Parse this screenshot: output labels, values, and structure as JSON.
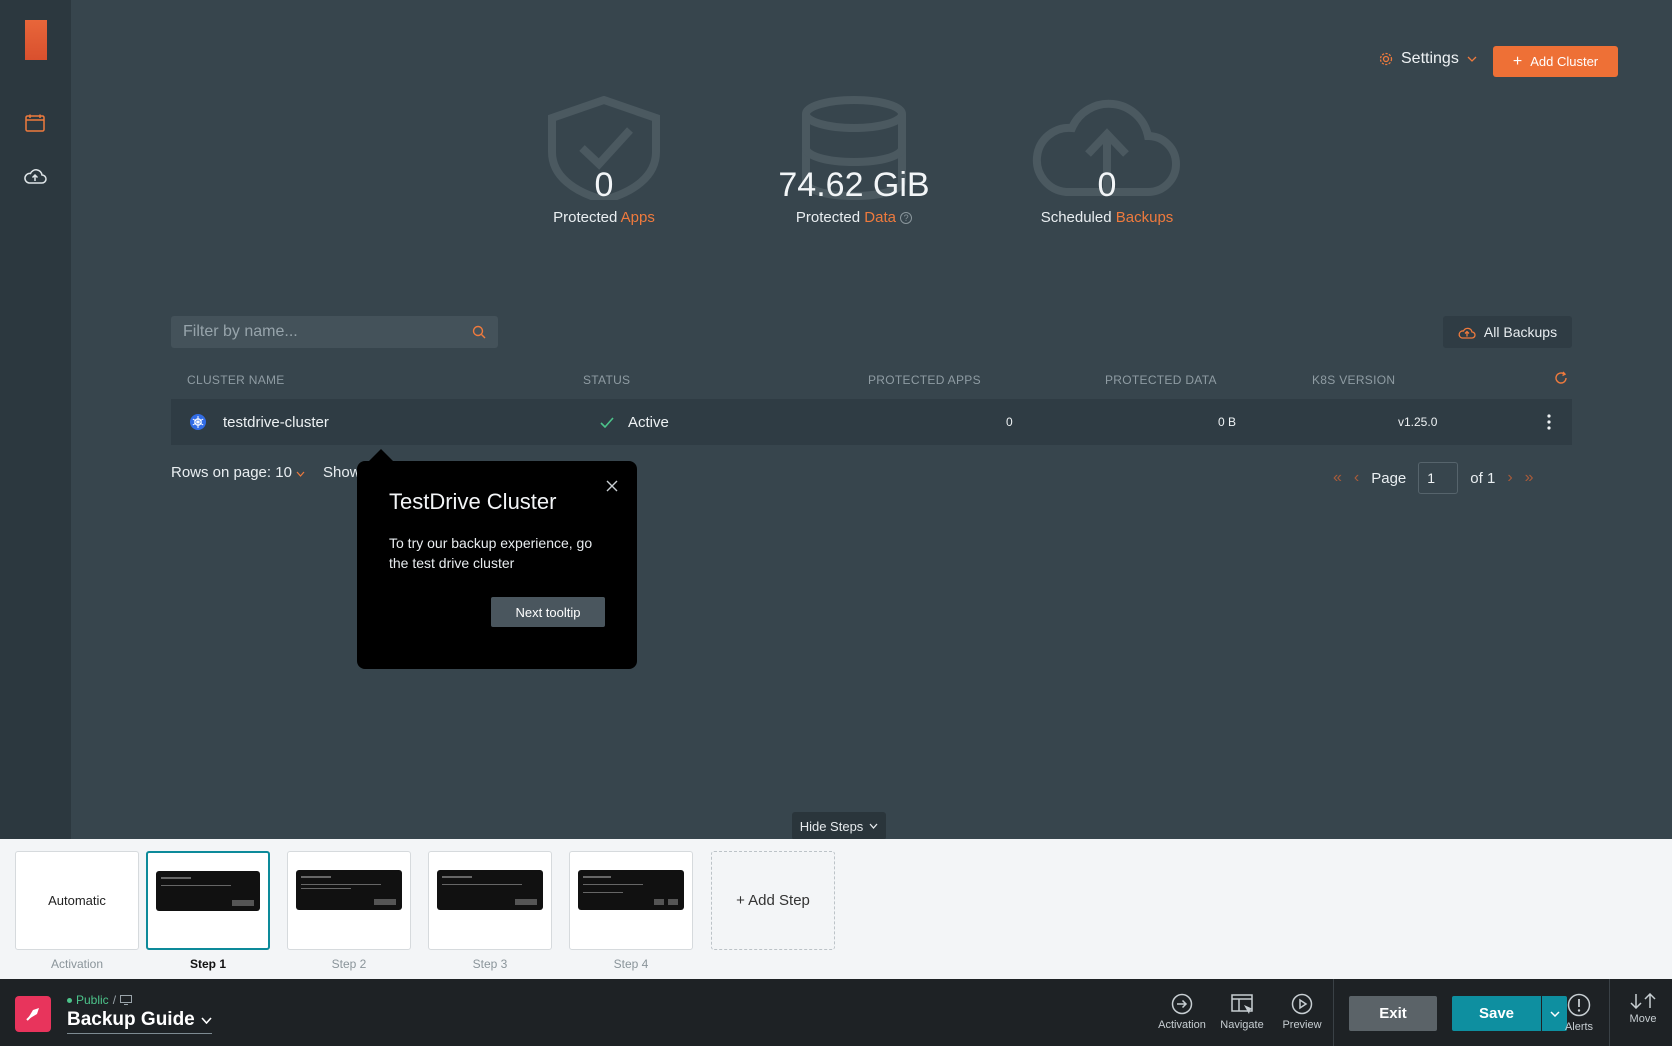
{
  "header": {
    "settings_label": "Settings",
    "add_cluster_label": "Add Cluster"
  },
  "stats": [
    {
      "value": "0",
      "label_prefix": "Protected",
      "label_accent": "Apps"
    },
    {
      "value": "74.62 GiB",
      "label_prefix": "Protected",
      "label_accent": "Data"
    },
    {
      "value": "0",
      "label_prefix": "Scheduled",
      "label_accent": "Backups"
    }
  ],
  "filter": {
    "placeholder": "Filter by name..."
  },
  "all_backups_label": "All Backups",
  "table": {
    "headers": [
      "CLUSTER NAME",
      "STATUS",
      "PROTECTED APPS",
      "PROTECTED DATA",
      "K8S VERSION"
    ],
    "rows": [
      {
        "name": "testdrive-cluster",
        "status": "Active",
        "protected_apps": "0",
        "protected_data": "0 B",
        "k8s_version": "v1.25.0"
      }
    ]
  },
  "pagination": {
    "rows_label": "Rows on page: 10",
    "show_label": "Show",
    "page_label": "Page",
    "page_value": "1",
    "of_label": "of 1"
  },
  "tooltip": {
    "title": "TestDrive Cluster",
    "body": "To try our backup experience, go the test drive cluster",
    "next_label": "Next tooltip"
  },
  "hide_steps_label": "Hide Steps",
  "steps": {
    "activation_card": "Automatic",
    "activation_label": "Activation",
    "items": [
      {
        "label": "Step 1"
      },
      {
        "label": "Step 2"
      },
      {
        "label": "Step 3"
      },
      {
        "label": "Step 4"
      }
    ],
    "add_step_label": "+ Add Step"
  },
  "toolbar": {
    "visibility": "Public",
    "slash": "/",
    "guide_name": "Backup Guide",
    "activation_label": "Activation",
    "navigate_label": "Navigate",
    "preview_label": "Preview",
    "exit_label": "Exit",
    "save_label": "Save",
    "alerts_label": "Alerts",
    "move_label": "Move"
  },
  "colors": {
    "accent": "#ee7036",
    "teal": "#0e8fa0",
    "status_active": "#4cc38a"
  }
}
